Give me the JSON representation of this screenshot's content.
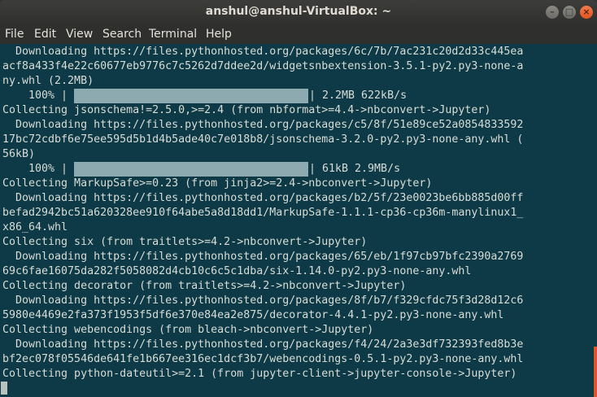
{
  "window": {
    "title": "anshul@anshul-VirtualBox: ~"
  },
  "window_buttons": {
    "minimize": "–",
    "maximize": "□",
    "close": "×"
  },
  "menu": {
    "file": "File",
    "edit": "Edit",
    "view": "View",
    "search": "Search",
    "terminal": "Terminal",
    "help": "Help"
  },
  "terminal": {
    "lines": [
      "  Downloading https://files.pythonhosted.org/packages/6c/7b/7ac231c20d2d33c445ea",
      "acf8a433f4e22c60677eb9776c7c5262d7ddee2d/widgetsnbextension-3.5.1-py2.py3-none-a",
      "ny.whl (2.2MB)",
      "    100% |",
      "Collecting jsonschema!=2.5.0,>=2.4 (from nbformat>=4.4->nbconvert->Jupyter)",
      "  Downloading https://files.pythonhosted.org/packages/c5/8f/51e89ce52a0854833592",
      "17bc72cdbf6e75ee595d5b1d4b5ade40c7e018b8/jsonschema-3.2.0-py2.py3-none-any.whl (",
      "56kB)",
      "    100% |",
      "Collecting MarkupSafe>=0.23 (from jinja2>=2.4->nbconvert->Jupyter)",
      "  Downloading https://files.pythonhosted.org/packages/b2/5f/23e0023be6bb885d00ff",
      "befad2942bc51a620328ee910f64abe5a8d18dd1/MarkupSafe-1.1.1-cp36-cp36m-manylinux1_",
      "x86_64.whl",
      "Collecting six (from traitlets>=4.2->nbconvert->Jupyter)",
      "  Downloading https://files.pythonhosted.org/packages/65/eb/1f97cb97bfc2390a2769",
      "69c6fae16075da282f5058082d4cb10c6c5c1dba/six-1.14.0-py2.py3-none-any.whl",
      "Collecting decorator (from traitlets>=4.2->nbconvert->Jupyter)",
      "  Downloading https://files.pythonhosted.org/packages/8f/b7/f329cfdc75f3d28d12c6",
      "5980e4469e2fa373f1953f5df6e370e84ea2e875/decorator-4.4.1-py2.py3-none-any.whl",
      "Collecting webencodings (from bleach->nbconvert->Jupyter)",
      "  Downloading https://files.pythonhosted.org/packages/f4/24/2a3e3df732393fed8b3e",
      "bf2ec078f05546de641fe1b667ee316ec1dcf3b7/webencodings-0.5.1-py2.py3-none-any.whl",
      "Collecting python-dateutil>=2.1 (from jupyter-client->jupyter-console->Jupyter)"
    ],
    "progress": [
      {
        "percent": "100%",
        "fraction": 1.0,
        "suffix": "| 2.2MB 622kB/s"
      },
      {
        "percent": "100%",
        "fraction": 1.0,
        "suffix": "| 61kB 2.9MB/s"
      }
    ]
  },
  "colors": {
    "terminal_bg": "#0d3a46",
    "text": "#d8dcd6",
    "progress_fill": "#8eaab1",
    "accent": "#e15621"
  }
}
